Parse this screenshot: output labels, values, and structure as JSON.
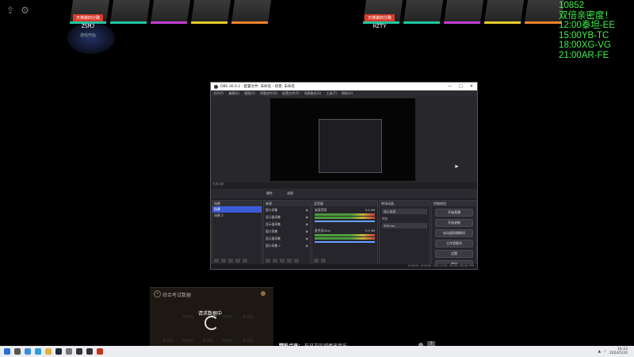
{
  "overlay": {
    "icons": [
      "upload-icon",
      "gear-icon"
    ],
    "cards_left_colors": [
      "#1fc7a0",
      "#1fc7a0",
      "#c33fd0",
      "#e4cc2a",
      "#f0822a"
    ],
    "cards_right_colors": [
      "#1fc7a0",
      "#1fc7a0",
      "#c33fd0",
      "#e4cc2a",
      "#f0822a"
    ],
    "player_left": {
      "tag": "天梯第四分路",
      "name": "ZSMJ",
      "sub": "游戏开始"
    },
    "player_right": {
      "tag": "天梯第四分路",
      "name": "HZTY"
    },
    "schedule": [
      "10852",
      "双倍亲密度！",
      "12:00泰坦-EE",
      "15:00YB-TC",
      "18:00XG-VG",
      "21:00AR-FE"
    ]
  },
  "obs": {
    "title": "OBS 30.0.2 - 配置文件: 未命名 - 场景: 未命名",
    "window_controls": [
      "—",
      "□",
      "✕"
    ],
    "menu": [
      "文件(F)",
      "编辑(E)",
      "视图(V)",
      "停靠部件(D)",
      "配置文件(P)",
      "场景集合(S)",
      "工具(T)",
      "帮助(H)"
    ],
    "source_bar": "无选中源",
    "scenebar_buttons": [
      "属性",
      "滤镜"
    ],
    "docks": {
      "scenes": {
        "title": "场景",
        "items": [
          "场景",
          "场景 2"
        ]
      },
      "sources": {
        "title": "来源",
        "items": [
          "窗口采集",
          "显示器采集",
          "显示器采集",
          "窗口采集",
          "显示器采集",
          "窗口采集 2"
        ]
      },
      "mixer": {
        "title": "混音器",
        "channels": [
          {
            "name": "桌面音频",
            "level": "0.0 dB"
          },
          {
            "name": "麦克风/Aux",
            "level": "0.0 dB"
          }
        ]
      },
      "transitions": {
        "title": "转场动画",
        "value": "淡入淡出",
        "duration_label": "时长",
        "duration": "300 ms"
      },
      "controls": {
        "title": "控制按钮",
        "buttons": [
          "开始直播",
          "开始录制",
          "启动虚拟摄像机",
          "工作室模式",
          "设置",
          "退出"
        ]
      }
    },
    "status": [
      "0:00:00",
      "0:00:00",
      "CPU: 0.3%",
      "60.00 / 60.00 FPS"
    ]
  },
  "panel": {
    "title": "综合考试数据",
    "loading_text": "请求数据中",
    "pct_values": [
      "0.0%",
      "0.0%",
      "0.0%",
      "0.0%",
      "0.0%",
      "0.0%",
      "0.0%",
      "0.0%"
    ]
  },
  "ticker": {
    "label": "精彩点评：",
    "text": "在日志区域播放音乐..."
  },
  "taskbar": {
    "icons": [
      "windows-icon",
      "search-icon",
      "chrome-icon",
      "edge-icon",
      "explorer-icon",
      "steam-icon",
      "media-icon",
      "terminal-icon",
      "obs-icon",
      "game-icon"
    ],
    "clock_time": "16:23",
    "clock_date": "2024/5/20"
  }
}
